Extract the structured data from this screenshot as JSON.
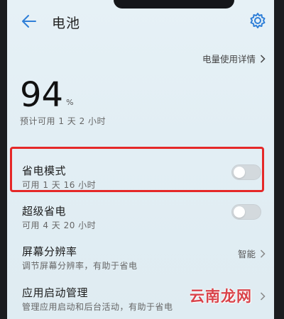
{
  "header": {
    "title": "电池"
  },
  "detail_link": "电量使用详情",
  "battery": {
    "level": "94",
    "percent_sign": "%",
    "estimate": "预计可用 1 天 2 小时"
  },
  "power_saving": {
    "title": "省电模式",
    "subtitle": "可用 1 天 16 小时",
    "enabled": false
  },
  "ultra_power_saving": {
    "title": "超级省电",
    "subtitle": "可用 4 天 20 小时",
    "enabled": false
  },
  "resolution": {
    "title": "屏幕分辨率",
    "subtitle": "调节屏幕分辨率，有助于省电",
    "value": "智能"
  },
  "app_launch": {
    "title": "应用启动管理",
    "subtitle": "管理应用启动和后台活动，有助于省电"
  },
  "watermark": "云南龙网",
  "colors": {
    "highlight": "#e52828",
    "accent_blue": "#2f7fd8",
    "watermark": "#d9434a"
  }
}
